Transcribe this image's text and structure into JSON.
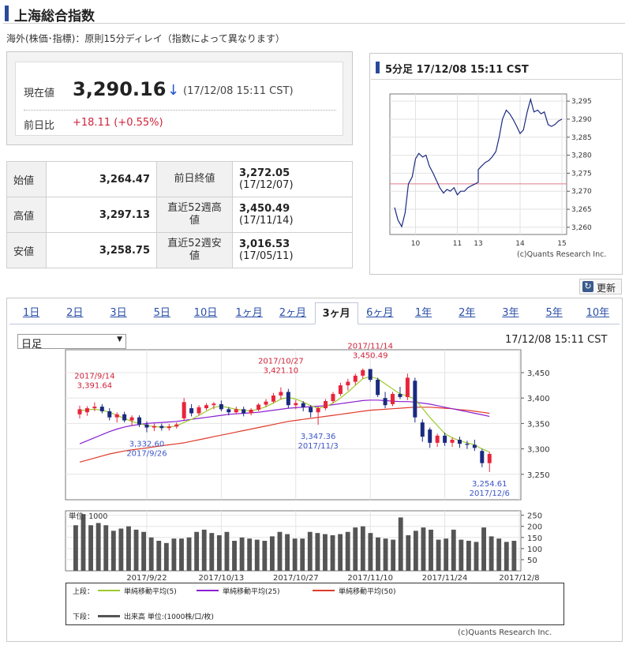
{
  "header": {
    "title": "上海総合指数"
  },
  "note": "海外(株価･指標)：原則15分ディレイ（指数によって異なります）",
  "quote": {
    "current_label": "現在値",
    "current_value": "3,290.16",
    "arrow": "↓",
    "time": "(17/12/08 15:11 CST)",
    "change_label": "前日比",
    "change_value": "+18.11 (+0.55%)"
  },
  "stats": [
    {
      "label": "始値",
      "value": "3,264.47",
      "label2": "前日終値",
      "value2": "3,272.05",
      "date2": "(17/12/07)"
    },
    {
      "label": "高値",
      "value": "3,297.13",
      "label2": "直近52週高値",
      "value2": "3,450.49",
      "date2": "(17/11/14)"
    },
    {
      "label": "安値",
      "value": "3,258.75",
      "label2": "直近52週安値",
      "value2": "3,016.53",
      "date2": "(17/05/11)"
    }
  ],
  "minute_chart": {
    "title": "5分足 17/12/08 15:11 CST",
    "copyright": "(c)Quants Research Inc."
  },
  "refresh": {
    "label": "更新",
    "icon": "refresh-icon"
  },
  "tabs": [
    "1日",
    "2日",
    "3日",
    "5日",
    "10日",
    "1ヶ月",
    "2ヶ月",
    "3ヶ月",
    "6ヶ月",
    "1年",
    "2年",
    "3年",
    "5年",
    "10年"
  ],
  "active_tab": "3ヶ月",
  "period_select": {
    "value": "日足"
  },
  "daily_chart_time": "17/12/08 15:11 CST",
  "legend": {
    "upper_label": "上段：",
    "ma5": "単純移動平均(5)",
    "ma25": "単純移動平均(25)",
    "ma50": "単純移動平均(50)",
    "lower_label": "下段：",
    "volume": "出来高 単位:(1000株/口/枚)"
  },
  "colors": {
    "up": "#e8253b",
    "down": "#1a2a80",
    "ma5": "#9ccc2c",
    "ma25": "#8a1fd0",
    "ma50": "#e03a2a",
    "accent": "#2a4a9a"
  },
  "chart_data": [
    {
      "type": "line",
      "title": "5分足 17/12/08 15:11 CST",
      "x_ticks": [
        "10",
        "11",
        "13",
        "14",
        "15"
      ],
      "y_ticks": [
        "3,295",
        "3,290",
        "3,285",
        "3,280",
        "3,275",
        "3,270",
        "3,265",
        "3,260"
      ],
      "ylim": [
        3258,
        3297
      ],
      "reference_line": 3272.05,
      "series": [
        {
          "values": [
            {
              "t": 9.5,
              "y": 3265.5
            },
            {
              "t": 9.58,
              "y": 3262.0
            },
            {
              "t": 9.67,
              "y": 3260.2
            },
            {
              "t": 9.75,
              "y": 3264.0
            },
            {
              "t": 9.83,
              "y": 3272.0
            },
            {
              "t": 9.92,
              "y": 3274.0
            },
            {
              "t": 10.0,
              "y": 3279.0
            },
            {
              "t": 10.08,
              "y": 3280.5
            },
            {
              "t": 10.17,
              "y": 3279.5
            },
            {
              "t": 10.25,
              "y": 3280.0
            },
            {
              "t": 10.33,
              "y": 3277.0
            },
            {
              "t": 10.42,
              "y": 3275.0
            },
            {
              "t": 10.5,
              "y": 3273.0
            },
            {
              "t": 10.58,
              "y": 3271.0
            },
            {
              "t": 10.67,
              "y": 3269.5
            },
            {
              "t": 10.75,
              "y": 3270.5
            },
            {
              "t": 10.83,
              "y": 3270.0
            },
            {
              "t": 10.92,
              "y": 3271.0
            },
            {
              "t": 11.0,
              "y": 3269.0
            },
            {
              "t": 11.08,
              "y": 3270.0
            },
            {
              "t": 11.17,
              "y": 3270.0
            },
            {
              "t": 11.25,
              "y": 3271.0
            },
            {
              "t": 11.33,
              "y": 3271.5
            },
            {
              "t": 11.42,
              "y": 3272.0
            },
            {
              "t": 11.5,
              "y": 3272.5
            },
            {
              "t": 13.0,
              "y": 3276.0
            },
            {
              "t": 13.08,
              "y": 3277.0
            },
            {
              "t": 13.17,
              "y": 3278.0
            },
            {
              "t": 13.25,
              "y": 3278.5
            },
            {
              "t": 13.33,
              "y": 3279.5
            },
            {
              "t": 13.42,
              "y": 3281.0
            },
            {
              "t": 13.5,
              "y": 3285.0
            },
            {
              "t": 13.58,
              "y": 3290.0
            },
            {
              "t": 13.67,
              "y": 3292.5
            },
            {
              "t": 13.75,
              "y": 3291.5
            },
            {
              "t": 13.83,
              "y": 3290.0
            },
            {
              "t": 13.92,
              "y": 3288.0
            },
            {
              "t": 14.0,
              "y": 3286.0
            },
            {
              "t": 14.08,
              "y": 3287.0
            },
            {
              "t": 14.17,
              "y": 3292.0
            },
            {
              "t": 14.25,
              "y": 3295.5
            },
            {
              "t": 14.33,
              "y": 3292.0
            },
            {
              "t": 14.42,
              "y": 3292.5
            },
            {
              "t": 14.5,
              "y": 3291.5
            },
            {
              "t": 14.58,
              "y": 3292.0
            },
            {
              "t": 14.67,
              "y": 3288.5
            },
            {
              "t": 14.75,
              "y": 3288.0
            },
            {
              "t": 14.83,
              "y": 3288.5
            },
            {
              "t": 14.92,
              "y": 3289.5
            },
            {
              "t": 15.0,
              "y": 3290.0
            }
          ]
        }
      ],
      "copyright": "(c)Quants Research Inc."
    },
    {
      "type": "candlestick",
      "y_ticks": [
        "3,450",
        "3,400",
        "3,350",
        "3,300",
        "3,250"
      ],
      "ylim": [
        3200,
        3495
      ],
      "x_labels": [
        {
          "i": 9,
          "label": "2017/9/22"
        },
        {
          "i": 19,
          "label": "2017/10/13"
        },
        {
          "i": 29,
          "label": "2017/10/27"
        },
        {
          "i": 39,
          "label": "2017/11/10"
        },
        {
          "i": 49,
          "label": "2017/11/24"
        },
        {
          "i": 59,
          "label": "2017/12/8"
        }
      ],
      "candles": [
        {
          "o": 3368,
          "h": 3385,
          "l": 3360,
          "c": 3378
        },
        {
          "o": 3372,
          "h": 3384,
          "l": 3365,
          "c": 3380
        },
        {
          "o": 3380,
          "h": 3391.64,
          "l": 3374,
          "c": 3383
        },
        {
          "o": 3383,
          "h": 3388,
          "l": 3370,
          "c": 3374
        },
        {
          "o": 3374,
          "h": 3380,
          "l": 3356,
          "c": 3362
        },
        {
          "o": 3362,
          "h": 3372,
          "l": 3352,
          "c": 3368
        },
        {
          "o": 3368,
          "h": 3373,
          "l": 3352,
          "c": 3356
        },
        {
          "o": 3356,
          "h": 3366,
          "l": 3345,
          "c": 3362
        },
        {
          "o": 3362,
          "h": 3366,
          "l": 3343,
          "c": 3348
        },
        {
          "o": 3348,
          "h": 3354,
          "l": 3332.6,
          "c": 3342
        },
        {
          "o": 3342,
          "h": 3350,
          "l": 3335,
          "c": 3345
        },
        {
          "o": 3345,
          "h": 3350,
          "l": 3336,
          "c": 3341
        },
        {
          "o": 3341,
          "h": 3349,
          "l": 3336,
          "c": 3344
        },
        {
          "o": 3344,
          "h": 3352,
          "l": 3340,
          "c": 3348
        },
        {
          "o": 3360,
          "h": 3400,
          "l": 3356,
          "c": 3392
        },
        {
          "o": 3380,
          "h": 3388,
          "l": 3364,
          "c": 3370
        },
        {
          "o": 3370,
          "h": 3386,
          "l": 3366,
          "c": 3382
        },
        {
          "o": 3380,
          "h": 3390,
          "l": 3376,
          "c": 3386
        },
        {
          "o": 3386,
          "h": 3392,
          "l": 3378,
          "c": 3389
        },
        {
          "o": 3388,
          "h": 3395,
          "l": 3374,
          "c": 3378
        },
        {
          "o": 3378,
          "h": 3382,
          "l": 3366,
          "c": 3372
        },
        {
          "o": 3372,
          "h": 3383,
          "l": 3368,
          "c": 3378
        },
        {
          "o": 3378,
          "h": 3383,
          "l": 3364,
          "c": 3370
        },
        {
          "o": 3370,
          "h": 3380,
          "l": 3366,
          "c": 3377
        },
        {
          "o": 3377,
          "h": 3390,
          "l": 3374,
          "c": 3387
        },
        {
          "o": 3387,
          "h": 3398,
          "l": 3382,
          "c": 3393
        },
        {
          "o": 3393,
          "h": 3410,
          "l": 3390,
          "c": 3405
        },
        {
          "o": 3405,
          "h": 3421.1,
          "l": 3398,
          "c": 3412
        },
        {
          "o": 3412,
          "h": 3418,
          "l": 3380,
          "c": 3386
        },
        {
          "o": 3386,
          "h": 3396,
          "l": 3378,
          "c": 3390
        },
        {
          "o": 3390,
          "h": 3394,
          "l": 3374,
          "c": 3382
        },
        {
          "o": 3382,
          "h": 3386,
          "l": 3362,
          "c": 3372
        },
        {
          "o": 3372,
          "h": 3384,
          "l": 3347.36,
          "c": 3380
        },
        {
          "o": 3380,
          "h": 3398,
          "l": 3376,
          "c": 3394
        },
        {
          "o": 3394,
          "h": 3412,
          "l": 3390,
          "c": 3408
        },
        {
          "o": 3408,
          "h": 3430,
          "l": 3404,
          "c": 3425
        },
        {
          "o": 3425,
          "h": 3438,
          "l": 3415,
          "c": 3432
        },
        {
          "o": 3432,
          "h": 3448,
          "l": 3426,
          "c": 3444
        },
        {
          "o": 3444,
          "h": 3458,
          "l": 3438,
          "c": 3455
        },
        {
          "o": 3457,
          "h": 3450.49,
          "l": 3432,
          "c": 3436
        },
        {
          "o": 3436,
          "h": 3440,
          "l": 3402,
          "c": 3406
        },
        {
          "o": 3400,
          "h": 3412,
          "l": 3380,
          "c": 3386
        },
        {
          "o": 3388,
          "h": 3412,
          "l": 3384,
          "c": 3408
        },
        {
          "o": 3408,
          "h": 3422,
          "l": 3398,
          "c": 3402
        },
        {
          "o": 3402,
          "h": 3448,
          "l": 3396,
          "c": 3440
        },
        {
          "o": 3434,
          "h": 3440,
          "l": 3352,
          "c": 3362
        },
        {
          "o": 3352,
          "h": 3358,
          "l": 3314,
          "c": 3324
        },
        {
          "o": 3338,
          "h": 3342,
          "l": 3302,
          "c": 3312
        },
        {
          "o": 3312,
          "h": 3330,
          "l": 3304,
          "c": 3326
        },
        {
          "o": 3326,
          "h": 3332,
          "l": 3306,
          "c": 3312
        },
        {
          "o": 3312,
          "h": 3322,
          "l": 3304,
          "c": 3318
        },
        {
          "o": 3318,
          "h": 3324,
          "l": 3302,
          "c": 3310
        },
        {
          "o": 3310,
          "h": 3316,
          "l": 3300,
          "c": 3308
        },
        {
          "o": 3308,
          "h": 3318,
          "l": 3296,
          "c": 3302
        },
        {
          "o": 3296,
          "h": 3300,
          "l": 3264,
          "c": 3272
        },
        {
          "o": 3272,
          "h": 3294,
          "l": 3254.61,
          "c": 3290
        }
      ],
      "annotations": [
        {
          "i": 2,
          "price": "3,391.64",
          "date": "2017/9/14",
          "kind": "high"
        },
        {
          "i": 9,
          "price": "3,332.60",
          "date": "2017/9/26",
          "kind": "low"
        },
        {
          "i": 27,
          "price": "3,421.10",
          "date": "2017/10/27",
          "kind": "high"
        },
        {
          "i": 32,
          "price": "3,347.36",
          "date": "2017/11/3",
          "kind": "low"
        },
        {
          "i": 39,
          "price": "3,450.49",
          "date": "2017/11/14",
          "kind": "high"
        },
        {
          "i": 55,
          "price": "3,254.61",
          "date": "2017/12/6",
          "kind": "low"
        }
      ],
      "ma5": [
        3375,
        3377,
        3378,
        3376,
        3372,
        3366,
        3360,
        3354,
        3350,
        3346,
        3344,
        3343,
        3343,
        3345,
        3352,
        3358,
        3366,
        3374,
        3382,
        3384,
        3381,
        3378,
        3376,
        3375,
        3378,
        3383,
        3390,
        3398,
        3401,
        3398,
        3392,
        3385,
        3380,
        3383,
        3390,
        3400,
        3412,
        3425,
        3438,
        3442,
        3438,
        3428,
        3418,
        3408,
        3404,
        3398,
        3380,
        3362,
        3346,
        3330,
        3322,
        3316,
        3312,
        3308,
        3300,
        3294
      ],
      "ma25": [
        3310,
        3316,
        3322,
        3328,
        3334,
        3339,
        3343,
        3346,
        3348,
        3350,
        3351,
        3352,
        3353,
        3354,
        3356,
        3358,
        3360,
        3362,
        3364,
        3366,
        3368,
        3369,
        3370,
        3371,
        3372,
        3374,
        3376,
        3378,
        3380,
        3381,
        3382,
        3383,
        3384,
        3385,
        3387,
        3389,
        3391,
        3393,
        3395,
        3396,
        3396,
        3395,
        3394,
        3393,
        3393,
        3392,
        3390,
        3388,
        3385,
        3382,
        3379,
        3376,
        3373,
        3370,
        3367,
        3364
      ],
      "ma50": [
        3274,
        3278,
        3282,
        3286,
        3290,
        3293,
        3296,
        3298,
        3300,
        3302,
        3304,
        3306,
        3308,
        3310,
        3312,
        3315,
        3318,
        3321,
        3324,
        3327,
        3330,
        3333,
        3336,
        3339,
        3342,
        3345,
        3348,
        3351,
        3354,
        3356,
        3358,
        3360,
        3362,
        3364,
        3366,
        3368,
        3370,
        3372,
        3374,
        3376,
        3377,
        3378,
        3379,
        3380,
        3381,
        3382,
        3382,
        3382,
        3381,
        3380,
        3379,
        3377,
        3376,
        3374,
        3372,
        3370
      ]
    },
    {
      "type": "bar",
      "title": "単位: 1000",
      "y_ticks": [
        "250",
        "200",
        "150",
        "100",
        "50"
      ],
      "ylim": [
        0,
        270
      ],
      "values": [
        205,
        255,
        205,
        215,
        205,
        180,
        190,
        200,
        185,
        175,
        150,
        135,
        125,
        145,
        145,
        150,
        175,
        185,
        170,
        160,
        175,
        135,
        150,
        145,
        140,
        135,
        155,
        175,
        165,
        145,
        145,
        175,
        170,
        165,
        160,
        165,
        175,
        195,
        200,
        170,
        150,
        145,
        140,
        240,
        160,
        180,
        195,
        185,
        140,
        145,
        185,
        140,
        135,
        130,
        195,
        155,
        145,
        130,
        135
      ]
    }
  ]
}
